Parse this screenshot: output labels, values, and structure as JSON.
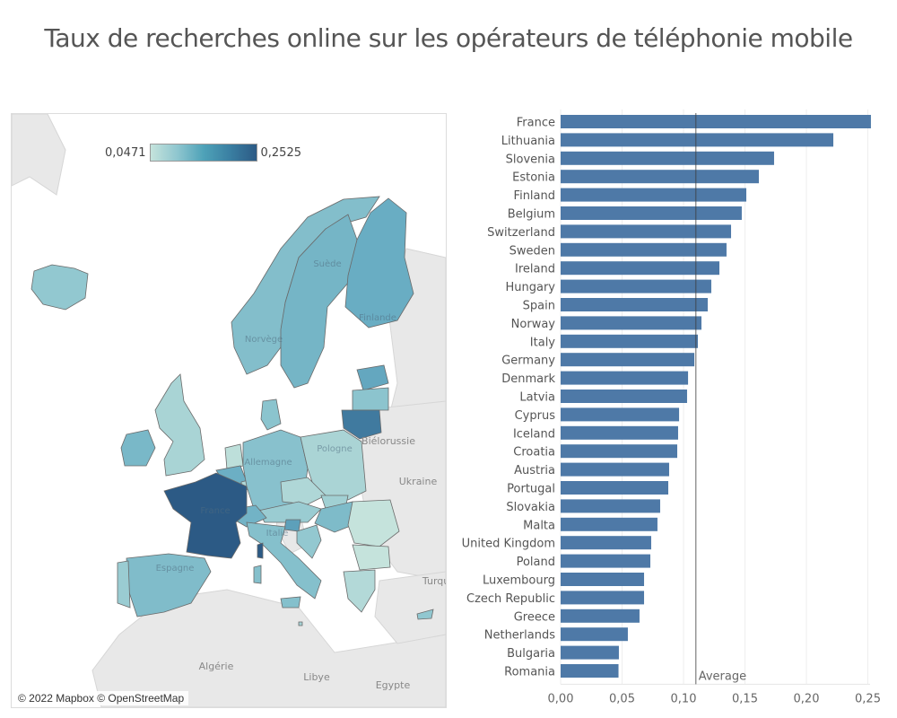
{
  "title": "Taux de recherches online sur les opérateurs de téléphonie mobile",
  "map": {
    "legend": {
      "min_label": "0,0471",
      "max_label": "0,2525",
      "min": 0.0471,
      "max": 0.2525,
      "color_low": "#c5e3dc",
      "color_high": "#2c5a85"
    },
    "attribution": "© 2022 Mapbox © OpenStreetMap",
    "country_labels": [
      "Suède",
      "Finlande",
      "Norvège",
      "Biélorussie",
      "Pologne",
      "Allemagne",
      "Ukraine",
      "France",
      "Italie",
      "Espagne",
      "Turquie",
      "Algérie",
      "Libye",
      "Egypte"
    ]
  },
  "chart_data": {
    "type": "bar",
    "orientation": "horizontal",
    "title": "Taux de recherches online sur les opérateurs de téléphonie mobile",
    "xlabel": "",
    "ylabel": "",
    "xlim": [
      0,
      0.26
    ],
    "grid": true,
    "bar_color": "#4e79a7",
    "x_ticks": [
      0,
      0.05,
      0.1,
      0.15,
      0.2,
      0.25
    ],
    "x_tick_labels": [
      "0,00",
      "0,05",
      "0,10",
      "0,15",
      "0,20",
      "0,25"
    ],
    "reference_line": {
      "label": "Average",
      "value": 0.11
    },
    "categories": [
      "France",
      "Lithuania",
      "Slovenia",
      "Estonia",
      "Finland",
      "Belgium",
      "Switzerland",
      "Sweden",
      "Ireland",
      "Hungary",
      "Spain",
      "Norway",
      "Italy",
      "Germany",
      "Denmark",
      "Latvia",
      "Cyprus",
      "Iceland",
      "Croatia",
      "Austria",
      "Portugal",
      "Slovakia",
      "Malta",
      "United Kingdom",
      "Poland",
      "Luxembourg",
      "Czech Republic",
      "Greece",
      "Netherlands",
      "Bulgaria",
      "Romania"
    ],
    "values": [
      0.2525,
      0.2219,
      0.1737,
      0.1613,
      0.1511,
      0.1474,
      0.1387,
      0.135,
      0.1292,
      0.1226,
      0.1197,
      0.1146,
      0.1117,
      0.1088,
      0.1037,
      0.1029,
      0.0964,
      0.0956,
      0.0949,
      0.0883,
      0.0876,
      0.081,
      0.0788,
      0.0737,
      0.073,
      0.0679,
      0.0679,
      0.0642,
      0.0547,
      0.0474,
      0.0471
    ]
  }
}
